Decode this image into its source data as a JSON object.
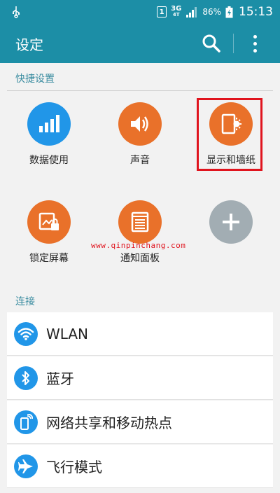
{
  "status_bar": {
    "sim_slot": "1",
    "network_type": "3G",
    "network_sub": "4T",
    "battery_percent": "86%",
    "time": "15:13"
  },
  "app_bar": {
    "title": "设定"
  },
  "quick_settings": {
    "header": "快捷设置",
    "items": [
      {
        "label": "数据使用",
        "icon": "data-usage-icon"
      },
      {
        "label": "声音",
        "icon": "sound-icon"
      },
      {
        "label": "显示和墙纸",
        "icon": "display-wallpaper-icon"
      },
      {
        "label": "锁定屏幕",
        "icon": "lock-screen-icon"
      },
      {
        "label": "通知面板",
        "icon": "notification-panel-icon"
      },
      {
        "label": "",
        "icon": "add-icon"
      }
    ]
  },
  "watermark": "www.qinpinchang.com",
  "connections": {
    "header": "连接",
    "items": [
      {
        "label": "WLAN",
        "icon": "wifi-icon"
      },
      {
        "label": "蓝牙",
        "icon": "bluetooth-icon"
      },
      {
        "label": "网络共享和移动热点",
        "icon": "hotspot-icon"
      },
      {
        "label": "飞行模式",
        "icon": "airplane-icon"
      }
    ]
  },
  "colors": {
    "accent": "#1c8ea6",
    "blue_icon": "#2196e8",
    "orange_icon": "#e9712a",
    "gray_icon": "#a2adb3",
    "highlight": "#e0141e"
  }
}
